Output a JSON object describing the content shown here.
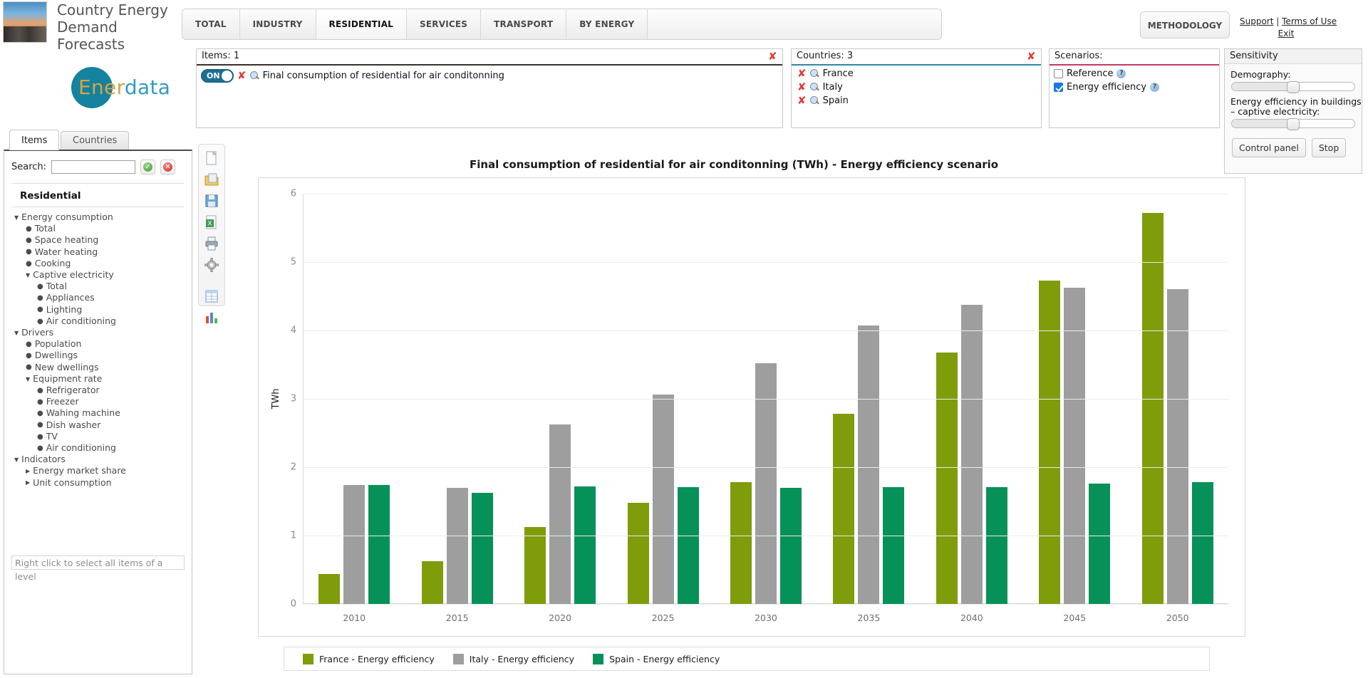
{
  "header": {
    "brand_title": "Country Energy Demand Forecasts",
    "logo_part_a": "Ener",
    "logo_part_b": "data",
    "tabs": [
      {
        "label": "TOTAL",
        "active": false
      },
      {
        "label": "INDUSTRY",
        "active": false
      },
      {
        "label": "RESIDENTIAL",
        "active": true
      },
      {
        "label": "SERVICES",
        "active": false
      },
      {
        "label": "TRANSPORT",
        "active": false
      },
      {
        "label": "BY ENERGY",
        "active": false
      }
    ],
    "methodology_label": "METHODOLOGY",
    "support_label": "Support",
    "separator": "|",
    "terms_label": "Terms of Use",
    "exit_label": "Exit"
  },
  "items_panel": {
    "title": "Items: 1",
    "close_icon": "close-icon",
    "rule_color": "#3b3028",
    "rows": [
      {
        "toggle": "ON",
        "label": "Final consumption of residential for air conditonning"
      }
    ]
  },
  "countries_panel": {
    "title": "Countries: 3",
    "close_icon": "close-icon",
    "rule_color": "#2e8aa8",
    "rows": [
      {
        "label": "France"
      },
      {
        "label": "Italy"
      },
      {
        "label": "Spain"
      }
    ]
  },
  "scenarios_panel": {
    "title": "Scenarios:",
    "rule_color": "#c33a67",
    "rows": [
      {
        "label": "Reference",
        "checked": false
      },
      {
        "label": "Energy efficiency",
        "checked": true
      }
    ]
  },
  "sensitivity_panel": {
    "title": "Sensitivity",
    "sliders": [
      {
        "label": "Demography:",
        "value": 50
      },
      {
        "label": "Energy efficiency in buildings – captive electricity:",
        "value": 50
      }
    ],
    "control_panel_label": "Control panel",
    "stop_label": "Stop"
  },
  "sidebar": {
    "tabs": [
      {
        "label": "Items",
        "active": true
      },
      {
        "label": "Countries",
        "active": false
      }
    ],
    "search_label": "Search:",
    "search_value": "",
    "search_placeholder": "",
    "root_label": "Residential",
    "tree": [
      {
        "label": "Energy consumption",
        "kind": "open",
        "indent": 0
      },
      {
        "label": "Total",
        "kind": "leaf",
        "indent": 1
      },
      {
        "label": "Space heating",
        "kind": "leaf",
        "indent": 1
      },
      {
        "label": "Water heating",
        "kind": "leaf",
        "indent": 1
      },
      {
        "label": "Cooking",
        "kind": "leaf",
        "indent": 1
      },
      {
        "label": "Captive electricity",
        "kind": "open",
        "indent": 1
      },
      {
        "label": "Total",
        "kind": "leaf",
        "indent": 2
      },
      {
        "label": "Appliances",
        "kind": "leaf",
        "indent": 2
      },
      {
        "label": "Lighting",
        "kind": "leaf",
        "indent": 2
      },
      {
        "label": "Air conditioning",
        "kind": "leaf",
        "indent": 2
      },
      {
        "label": "Drivers",
        "kind": "open",
        "indent": 0
      },
      {
        "label": "Population",
        "kind": "leaf",
        "indent": 1
      },
      {
        "label": "Dwellings",
        "kind": "leaf",
        "indent": 1
      },
      {
        "label": "New dwellings",
        "kind": "leaf",
        "indent": 1
      },
      {
        "label": "Equipment rate",
        "kind": "open",
        "indent": 1
      },
      {
        "label": "Refrigerator",
        "kind": "leaf",
        "indent": 2
      },
      {
        "label": "Freezer",
        "kind": "leaf",
        "indent": 2
      },
      {
        "label": "Wahing machine",
        "kind": "leaf",
        "indent": 2
      },
      {
        "label": "Dish washer",
        "kind": "leaf",
        "indent": 2
      },
      {
        "label": "TV",
        "kind": "leaf",
        "indent": 2
      },
      {
        "label": "Air conditioning",
        "kind": "leaf",
        "indent": 2
      },
      {
        "label": "Indicators",
        "kind": "open",
        "indent": 0
      },
      {
        "label": "Energy market share",
        "kind": "closed",
        "indent": 1
      },
      {
        "label": "Unit consumption",
        "kind": "closed",
        "indent": 1
      }
    ],
    "hint": "Right click to select all items of a level"
  },
  "chart_toolbar": {
    "icons": [
      "new-document-icon",
      "open-folder-icon",
      "save-disk-icon",
      "export-excel-icon",
      "print-icon",
      "gear-icon",
      "table-view-icon",
      "chart-view-icon"
    ]
  },
  "chart_data": {
    "type": "bar",
    "title": "Final consumption of residential for air conditonning (TWh) - Energy efficiency scenario",
    "xlabel": "",
    "ylabel": "TWh",
    "ylim": [
      0,
      6
    ],
    "yticks": [
      0,
      1,
      2,
      3,
      4,
      5,
      6
    ],
    "grid": true,
    "legend_position": "bottom",
    "categories": [
      "2010",
      "2015",
      "2020",
      "2025",
      "2030",
      "2035",
      "2040",
      "2045",
      "2050"
    ],
    "series": [
      {
        "name": "France - Energy efficiency",
        "color": "#7f9c0b",
        "values": [
          0.44,
          0.63,
          1.13,
          1.48,
          1.78,
          2.78,
          3.68,
          4.73,
          5.72
        ]
      },
      {
        "name": "Italy - Energy efficiency",
        "color": "#9e9e9e",
        "values": [
          1.74,
          1.7,
          2.62,
          3.06,
          3.52,
          4.07,
          4.37,
          4.62,
          4.6
        ]
      },
      {
        "name": "Spain - Energy efficiency",
        "color": "#059158",
        "values": [
          1.74,
          1.62,
          1.72,
          1.71,
          1.7,
          1.71,
          1.71,
          1.76,
          1.78
        ]
      }
    ]
  }
}
